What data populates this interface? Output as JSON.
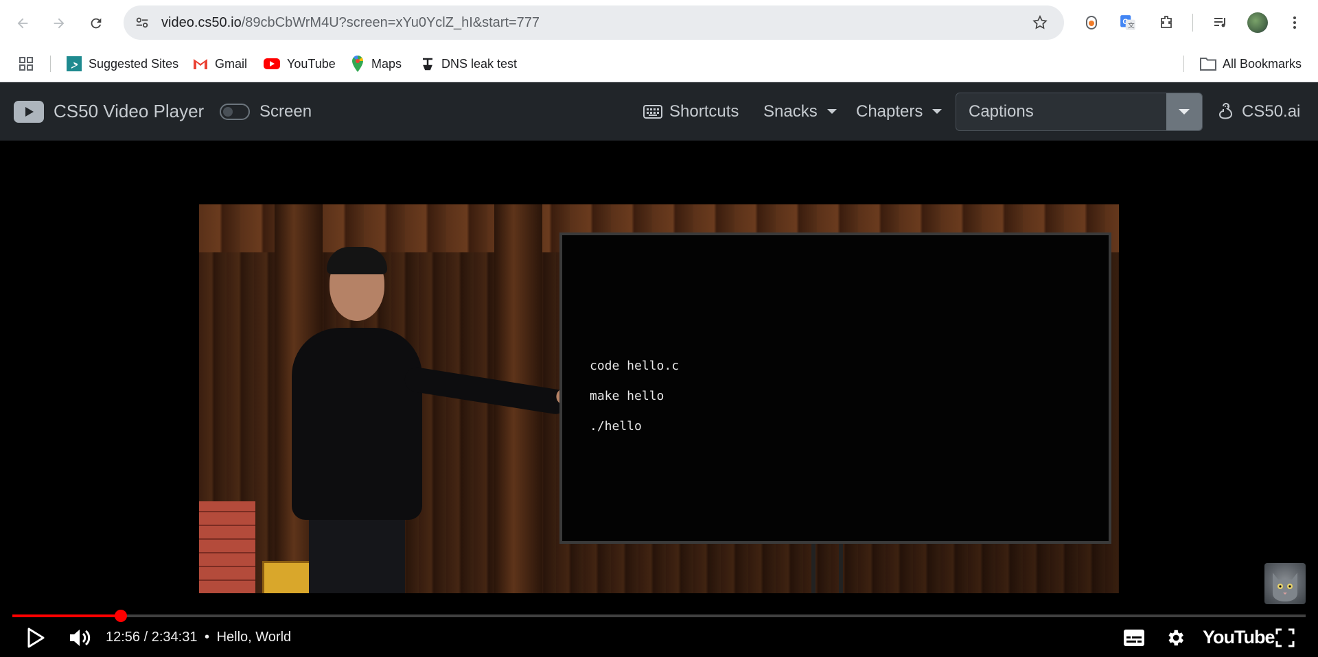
{
  "browser": {
    "url_host": "video.cs50.io",
    "url_path": "/89cbCbWrM4U?screen=xYu0YclZ_hI&start=777",
    "bookmarks": [
      {
        "label": "Suggested Sites",
        "icon": "bing-icon"
      },
      {
        "label": "Gmail",
        "icon": "gmail-icon"
      },
      {
        "label": "YouTube",
        "icon": "youtube-icon"
      },
      {
        "label": "Maps",
        "icon": "maps-icon"
      },
      {
        "label": "DNS leak test",
        "icon": "dns-icon"
      }
    ],
    "all_bookmarks": "All Bookmarks"
  },
  "navbar": {
    "brand": "CS50 Video Player",
    "screen_toggle_label": "Screen",
    "shortcuts": "Shortcuts",
    "snacks": "Snacks",
    "chapters": "Chapters",
    "captions": "Captions",
    "ai_link": "CS50.ai"
  },
  "video": {
    "code_lines": [
      "code hello.c",
      "make hello",
      "./hello"
    ]
  },
  "player": {
    "current_time": "12:56",
    "duration": "2:34:31",
    "chapter": "Hello, World",
    "time_display": "12:56 / 2:34:31",
    "chapter_sep": "•",
    "progress_fraction": 0.0837,
    "logo": "YouTube",
    "accent": "#ff0000"
  }
}
